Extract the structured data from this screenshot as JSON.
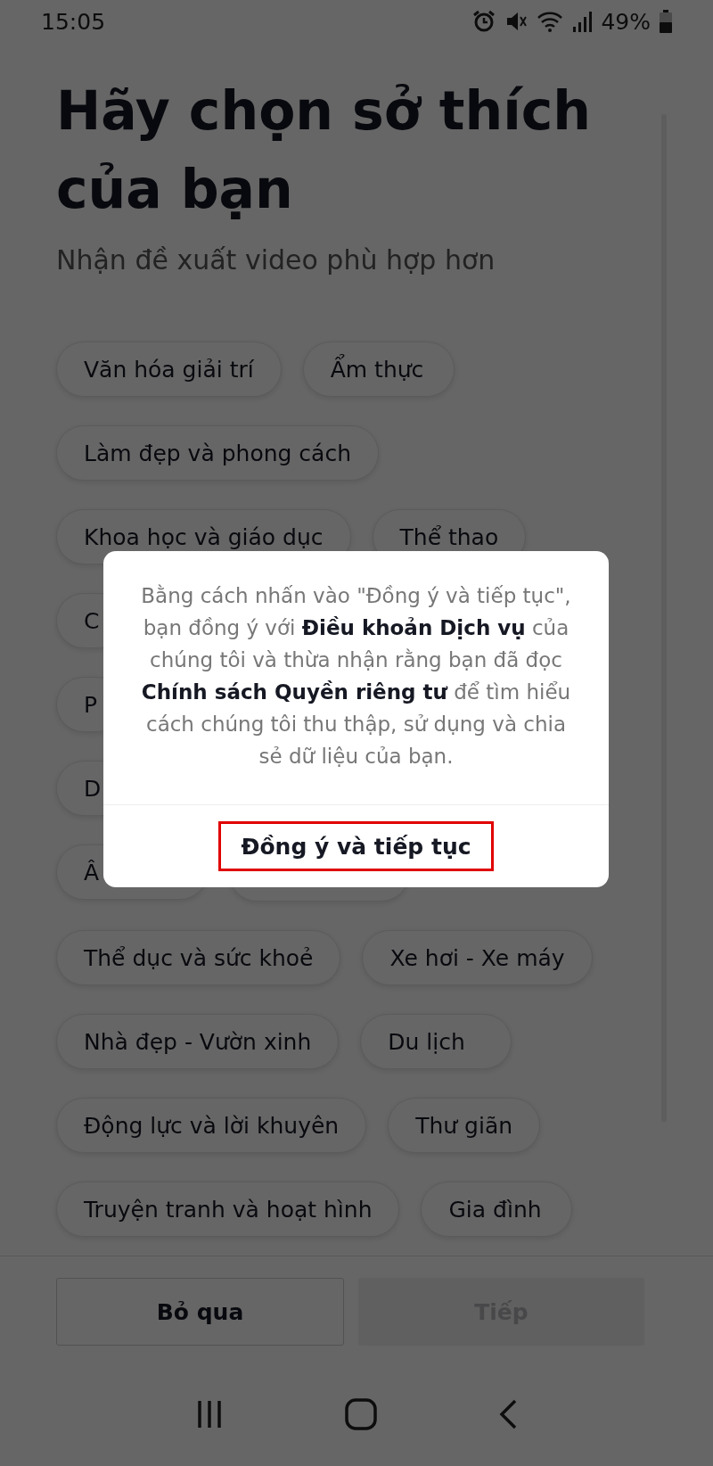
{
  "status_bar": {
    "time": "15:05",
    "battery": "49%"
  },
  "title": "Hãy chọn sở thích của bạn",
  "subtitle": "Nhận đề xuất video phù hợp hơn",
  "interest_rows": [
    {
      "chips": [
        {
          "label": "Văn hóa giải trí"
        },
        {
          "label": "Ẩm thực"
        }
      ]
    },
    {
      "chips": [
        {
          "label": "Làm đẹp và phong cách"
        }
      ]
    },
    {
      "chips": [
        {
          "label": "Khoa học và giáo dục"
        },
        {
          "label": "Thể thao"
        }
      ]
    },
    {
      "chips": [
        {
          "label": "C"
        }
      ]
    },
    {
      "chips": [
        {
          "label": "P"
        }
      ]
    },
    {
      "chips": [
        {
          "label": "D"
        }
      ]
    },
    {
      "chips": [
        {
          "label": "Â"
        },
        {
          "kind": "covered"
        }
      ]
    },
    {
      "chips": [
        {
          "label": "Thể dục và sức khoẻ"
        },
        {
          "label": "Xe hơi - Xe máy"
        }
      ]
    },
    {
      "chips": [
        {
          "label": "Nhà đẹp - Vườn xinh"
        },
        {
          "label": "Du lịch"
        }
      ]
    },
    {
      "chips": [
        {
          "label": "Động lực và lời khuyên"
        },
        {
          "label": "Thư giãn"
        }
      ]
    },
    {
      "chips": [
        {
          "label": "Truyện tranh và hoạt hình"
        },
        {
          "label": "Gia đình"
        }
      ]
    }
  ],
  "footer_buttons": [
    {
      "label": "Bỏ qua",
      "disabled": false
    },
    {
      "label": "Tiếp",
      "disabled": true
    }
  ],
  "dialog": {
    "message": "Bằng cách nhấn vào \"Đồng ý và tiếp tục\", bạn đồng ý với **Điều khoản Dịch vụ** của chúng tôi và thừa nhận rằng bạn đã đọc **Chính sách Quyền riêng tư** để tìm hiểu cách chúng tôi thu thập, sử dụng và chia sẻ dữ liệu của bạn.",
    "confirm": {
      "label": "Đồng ý và tiếp tục",
      "highlighted": true
    }
  }
}
